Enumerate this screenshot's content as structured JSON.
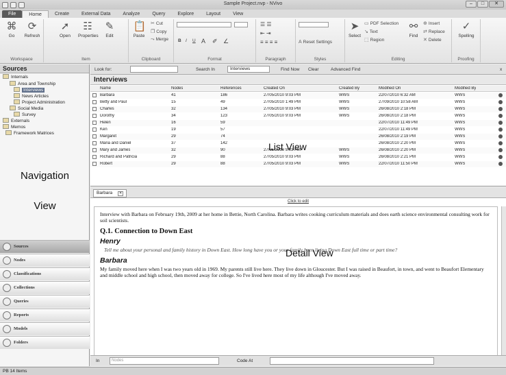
{
  "window": {
    "title": "Sample Project.nvp - NVivo"
  },
  "tabs": [
    "File",
    "Home",
    "Create",
    "External Data",
    "Analyze",
    "Query",
    "Explore",
    "Layout",
    "View"
  ],
  "ribbon": {
    "workspace": {
      "label": "Workspace",
      "go": "Go",
      "refresh": "Refresh"
    },
    "item": {
      "label": "Item",
      "open": "Open",
      "properties": "Properties",
      "edit": "Edit"
    },
    "clipboard": {
      "label": "Clipboard",
      "paste": "Paste",
      "cut": "Cut",
      "copy": "Copy",
      "merge": "Merge"
    },
    "format": {
      "label": "Format",
      "bold": "B",
      "italic": "I",
      "underline": "U"
    },
    "paragraph": {
      "label": "Paragraph"
    },
    "styles": {
      "label": "Styles",
      "reset": "Reset Settings"
    },
    "editing": {
      "label": "Editing",
      "select": "Select",
      "pdf_selection": "PDF Selection",
      "text": "Text",
      "region": "Region",
      "find": "Find",
      "insert": "Insert",
      "replace": "Replace",
      "delete": "Delete"
    },
    "proofing": {
      "label": "Proofing",
      "spelling": "Spelling"
    }
  },
  "findbar": {
    "look_for": "Look for:",
    "search_in": "Search In",
    "scope": "Interviews",
    "find_now": "Find Now",
    "clear": "Clear",
    "advanced": "Advanced Find",
    "close": "x"
  },
  "nav": {
    "header": "Sources",
    "tree": [
      "Internals",
      "Area and Township",
      "Interviews",
      "News Articles",
      "Project Administration",
      "Social Media",
      "Survey",
      "Externals",
      "Memos",
      "Framework Matrices"
    ],
    "overlay_line1": "Navigation",
    "overlay_line2": "View",
    "buttons": [
      "Sources",
      "Nodes",
      "Classifications",
      "Collections",
      "Queries",
      "Reports",
      "Models",
      "Folders"
    ]
  },
  "list": {
    "title": "Interviews",
    "overlay": "List View",
    "columns": [
      "Name",
      "Nodes",
      "References",
      "Created On",
      "Created By",
      "Modified On",
      "Modified By"
    ],
    "rows": [
      [
        "Barbara",
        "41",
        "186",
        "27/05/2010 9:03 PM",
        "WWS",
        "22/07/2010 6:32 AM",
        "WWS"
      ],
      [
        "Betty and Paul",
        "15",
        "49",
        "27/05/2010 1:49 PM",
        "WWS",
        "27/09/2010 10:58 AM",
        "WWS"
      ],
      [
        "Charles",
        "32",
        "134",
        "27/05/2010 9:03 PM",
        "WWS",
        "26/08/2010 2:18 PM",
        "WWS"
      ],
      [
        "Dorothy",
        "34",
        "123",
        "27/05/2010 9:03 PM",
        "WWS",
        "26/08/2010 2:18 PM",
        "WWS"
      ],
      [
        "Helen",
        "16",
        "59",
        "",
        "",
        "22/07/2010 11:49 PM",
        "WWS"
      ],
      [
        "Ken",
        "19",
        "57",
        "",
        "",
        "22/07/2010 11:49 PM",
        "WWS"
      ],
      [
        "Margaret",
        "29",
        "74",
        "",
        "",
        "26/08/2010 2:19 PM",
        "WWS"
      ],
      [
        "Maria and Daniel",
        "37",
        "142",
        "",
        "",
        "26/08/2010 2:20 PM",
        "WWS"
      ],
      [
        "Mary and James",
        "32",
        "90",
        "27/05/2010 9:03 PM",
        "WWS",
        "26/08/2010 2:20 PM",
        "WWS"
      ],
      [
        "Richard and Patricia",
        "29",
        "88",
        "27/05/2010 9:03 PM",
        "WWS",
        "26/08/2010 2:21 PM",
        "WWS"
      ],
      [
        "Robert",
        "29",
        "88",
        "27/05/2010 9:03 PM",
        "WWS",
        "22/07/2010 11:50 PM",
        "WWS"
      ]
    ]
  },
  "detail": {
    "tab": "Barbara",
    "click_to_edit": "Click to edit",
    "overlay": "Detail View",
    "intro": "Interview with Barbara on February 19th, 2009 at her home in Bettie, North Carolina. Barbara writes cooking curriculum materials and does earth science environmental consulting work for soil scientists.",
    "heading": "Q.1. Connection to Down East",
    "speaker1": "Henry",
    "question": "Tell me about your personal and family history in Down East. How long have you or your family been living Down East full time or part time?",
    "speaker2": "Barbara",
    "answer": "My family moved here when I was two years old in 1969. My parents still live here. They live down in Gloucester. But I was raised in Beaufort, in town, and went to Beaufort Elementary and middle school and high school, then moved away for college. So I've lived here most of my life although I've moved away."
  },
  "bottombar": {
    "in": "In",
    "nodes_placeholder": "Nodes",
    "code_at": "Code At"
  },
  "status": {
    "text": "PB  14 Items"
  }
}
